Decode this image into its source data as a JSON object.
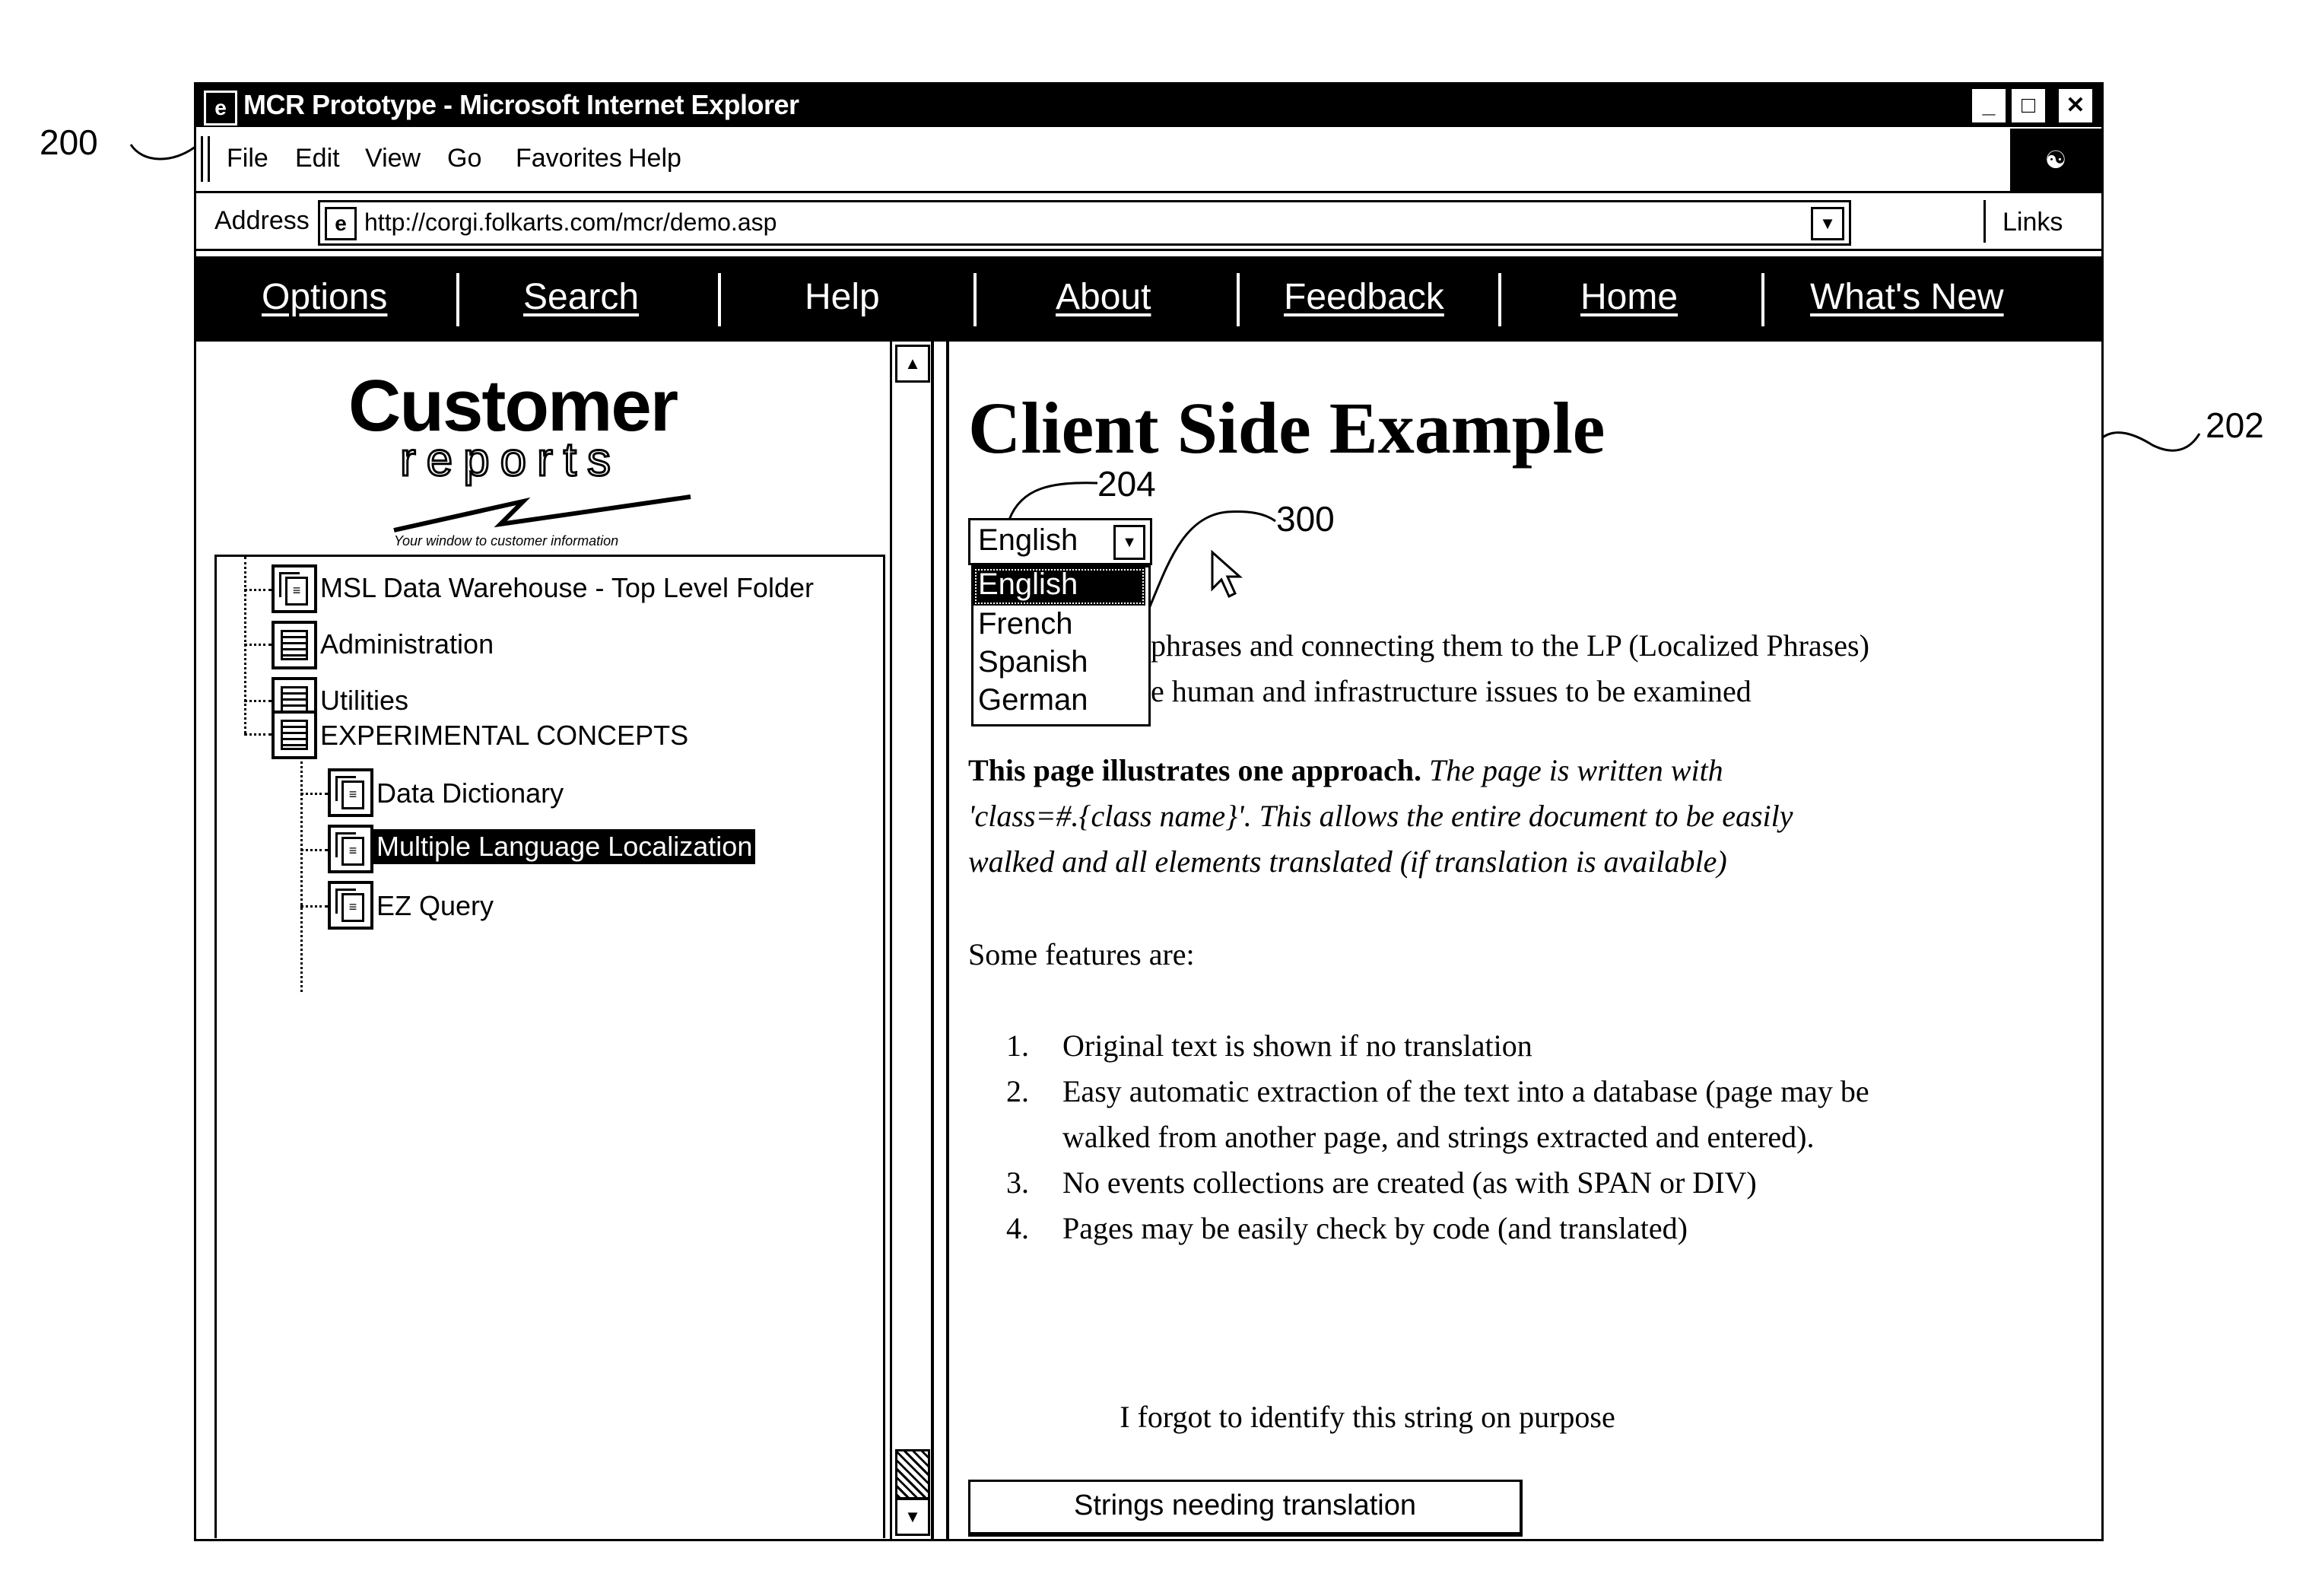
{
  "annotations": {
    "ref_200": "200",
    "ref_202": "202",
    "ref_204": "204",
    "ref_300": "300"
  },
  "window": {
    "title": "MCR Prototype - Microsoft Internet Explorer",
    "app_icon": "ie-icon",
    "controls": {
      "minimize": "_",
      "maximize": "□",
      "close": "✕"
    }
  },
  "menubar": {
    "items": [
      {
        "label": "File",
        "accel": "F"
      },
      {
        "label": "Edit",
        "accel": "E"
      },
      {
        "label": "View",
        "accel": "V"
      },
      {
        "label": "Go",
        "accel": "G"
      },
      {
        "label": "Favorites",
        "accel": "a"
      },
      {
        "label": "Help",
        "accel": "H"
      }
    ],
    "throbber": "ie-logo-icon"
  },
  "addressbar": {
    "label": "Address",
    "url": "http://corgi.folkarts.com/mcr/demo.asp",
    "links_label": "Links"
  },
  "navbar": {
    "items": [
      {
        "label": "Options",
        "link": true
      },
      {
        "label": "Search",
        "link": true
      },
      {
        "label": "Help",
        "link": false
      },
      {
        "label": "About",
        "link": true
      },
      {
        "label": "Feedback",
        "link": true
      },
      {
        "label": "Home",
        "link": true
      },
      {
        "label": "What's New",
        "link": true
      }
    ]
  },
  "sidebar": {
    "logo": {
      "main": "Customer",
      "sub": "reports",
      "tagline": "Your window to customer information"
    },
    "tree": [
      {
        "label": "MSL Data Warehouse - Top Level Folder",
        "icon": "report-folder-icon",
        "level": 0,
        "selected": false
      },
      {
        "label": "Administration",
        "icon": "folder-list-icon",
        "level": 0,
        "selected": false
      },
      {
        "label": "Utilities",
        "icon": "folder-list-icon",
        "level": 0,
        "selected": false
      },
      {
        "label": "EXPERIMENTAL CONCEPTS",
        "icon": "folder-list-icon",
        "level": 0,
        "selected": false
      },
      {
        "label": "Data Dictionary",
        "icon": "report-folder-icon",
        "level": 1,
        "selected": false
      },
      {
        "label": "Multiple Language Localization",
        "icon": "report-folder-icon",
        "level": 1,
        "selected": true
      },
      {
        "label": "EZ Query",
        "icon": "report-folder-icon",
        "level": 1,
        "selected": false
      }
    ]
  },
  "main": {
    "heading": "Client Side Example",
    "language_select": {
      "value": "English",
      "options": [
        "English",
        "French",
        "Spanish",
        "German"
      ],
      "highlighted": "English"
    },
    "intro_line1": "phrases and connecting them to the LP (Localized Phrases)",
    "intro_line2": "e human and infrastructure issues to be examined",
    "approach_bold": "This page illustrates one approach.",
    "approach_italic_1": " The page is written with",
    "approach_italic_2": "'class=#.{class name}'. This allows the entire document to be easily",
    "approach_italic_3": "walked and all elements translated (if translation is available)",
    "features_intro": "Some features are:",
    "features": [
      {
        "num": "1.",
        "lines": [
          "Original text is shown if no translation"
        ]
      },
      {
        "num": "2.",
        "lines": [
          "Easy automatic extraction of the text into a database (page may be",
          "walked from another page, and strings extracted and entered)."
        ]
      },
      {
        "num": "3.",
        "lines": [
          "No events collections are created (as with SPAN or DIV)"
        ]
      },
      {
        "num": "4.",
        "lines": [
          "Pages may be easily check by code (and translated)"
        ]
      }
    ],
    "unidentified_string": "I forgot to identify this string on purpose",
    "button_label": "Strings needing translation"
  }
}
